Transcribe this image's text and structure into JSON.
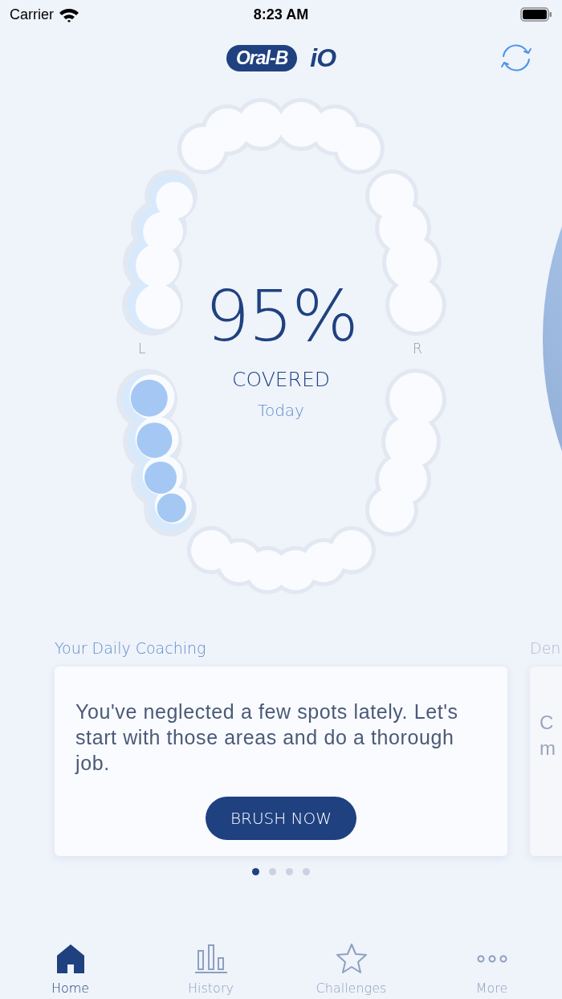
{
  "status_bar": {
    "carrier": "Carrier",
    "time": "8:23 AM"
  },
  "header": {
    "brand": "Oral-B",
    "product": "iO"
  },
  "coverage": {
    "value": "95%",
    "label": "COVERED",
    "period": "Today",
    "left_label": "L",
    "right_label": "R",
    "zones": [
      {
        "kind": "brushed"
      },
      {
        "kind": "attention"
      },
      {
        "kind": "brushed"
      },
      {
        "kind": "missed"
      },
      {
        "kind": "brushed"
      },
      {
        "kind": "brushed"
      }
    ]
  },
  "coaching": {
    "title": "Your Daily Coaching",
    "message": "You've neglected a few spots lately. Let's start with those areas and do a thorough job.",
    "button": "BRUSH NOW"
  },
  "next_card": {
    "title": "Den",
    "lines": [
      "C",
      "m"
    ]
  },
  "pager": [
    {
      "selected": true
    },
    {
      "selected": false
    },
    {
      "selected": false
    },
    {
      "selected": false
    }
  ],
  "tabs": [
    {
      "label": "Home",
      "selected": true
    },
    {
      "label": "History",
      "selected": false
    },
    {
      "label": "Challenges",
      "selected": false
    },
    {
      "label": "More",
      "selected": false
    }
  ]
}
